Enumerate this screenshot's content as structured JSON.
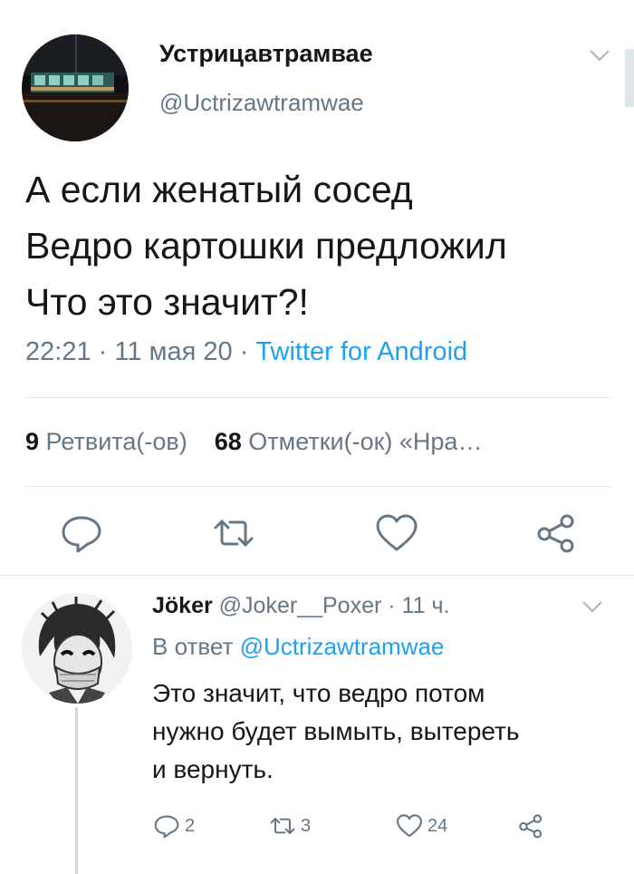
{
  "tweet": {
    "author": {
      "display_name": "Устрицавтрамвае",
      "handle": "@Uctrizawtramwae"
    },
    "text": "А если женатый сосед\nВедро картошки предложил\nЧто это значит?!",
    "time": "22:21",
    "date": "11 мая 20",
    "separator": "·",
    "source": "Twitter for Android",
    "stats": {
      "retweets_count": "9",
      "retweets_label": "Ретвита(-ов)",
      "likes_count": "68",
      "likes_label": "Отметки(-ок) «Нра…"
    },
    "actions": [
      "reply-icon",
      "retweet-icon",
      "like-icon",
      "share-icon"
    ]
  },
  "reply": {
    "author": {
      "display_name": "Jöker",
      "handle": "@Joker__Poxer"
    },
    "time": "11 ч.",
    "separator": "·",
    "reply_to_label": "В ответ",
    "reply_to_handle": "@Uctrizawtramwae",
    "text": "Это значит, что ведро потом\nнужно будет вымыть, вытереть\nи вернуть.",
    "counts": {
      "replies": "2",
      "retweets": "3",
      "likes": "24"
    }
  },
  "colors": {
    "accent": "#1da1f2",
    "text": "#14171a",
    "secondary": "#657786",
    "divider": "#e1e8ed"
  }
}
